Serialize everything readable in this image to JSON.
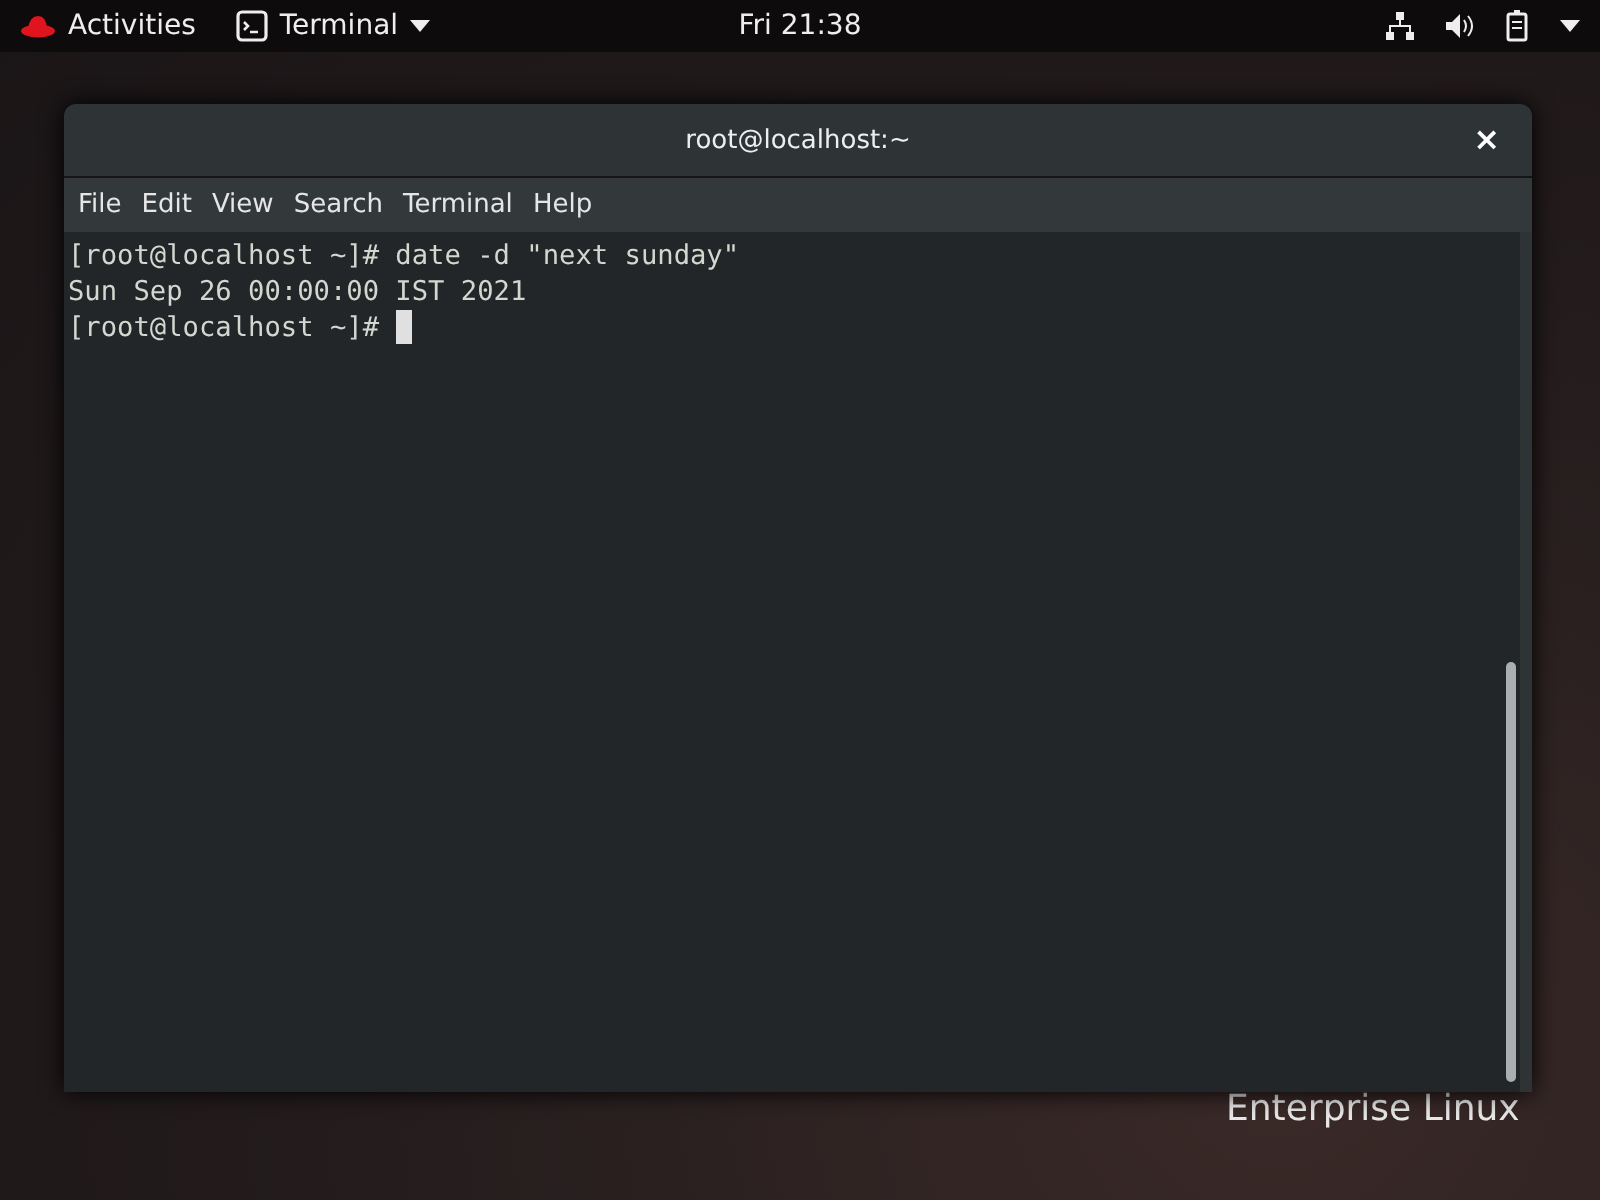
{
  "top_bar": {
    "activities": "Activities",
    "app_menu": "Terminal",
    "clock": "Fri 21:38"
  },
  "desktop": {
    "brand_text": "Enterprise Linux"
  },
  "window": {
    "title": "root@localhost:~",
    "close": "×",
    "menu": [
      "File",
      "Edit",
      "View",
      "Search",
      "Terminal",
      "Help"
    ],
    "lines": [
      "[root@localhost ~]# date -d \"next sunday\"",
      "Sun Sep 26 00:00:00 IST 2021",
      "[root@localhost ~]# "
    ],
    "cursor": true
  }
}
